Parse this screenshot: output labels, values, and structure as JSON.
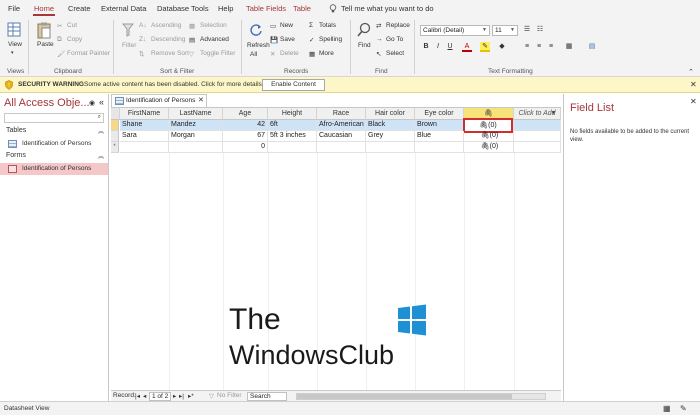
{
  "menu": {
    "tabs": [
      "File",
      "Home",
      "Create",
      "External Data",
      "Database Tools",
      "Help"
    ],
    "context_tabs": [
      "Table Fields",
      "Table"
    ],
    "tell_me": "Tell me what you want to do"
  },
  "ribbon": {
    "views": {
      "view": "View",
      "group": "Views"
    },
    "clipboard": {
      "paste": "Paste",
      "cut": "Cut",
      "copy": "Copy",
      "format_painter": "Format Painter",
      "group": "Clipboard"
    },
    "sort_filter": {
      "filter": "Filter",
      "ascending": "Ascending",
      "descending": "Descending",
      "remove_sort": "Remove Sort",
      "selection": "Selection",
      "advanced": "Advanced",
      "toggle_filter": "Toggle Filter",
      "group": "Sort & Filter"
    },
    "records": {
      "refresh": "Refresh",
      "refresh_all": "All",
      "new": "New",
      "save": "Save",
      "delete": "Delete",
      "totals": "Totals",
      "spelling": "Spelling",
      "more": "More",
      "group": "Records"
    },
    "find": {
      "find": "Find",
      "replace": "Replace",
      "goto": "Go To",
      "select": "Select",
      "group": "Find"
    },
    "text_formatting": {
      "font": "Calibri (Detail)",
      "size": "11",
      "bold": "B",
      "italic": "I",
      "underline": "U",
      "font_color": "A",
      "group": "Text Formatting"
    }
  },
  "security": {
    "label": "SECURITY WARNING",
    "message": "Some active content has been disabled. Click for more details.",
    "button": "Enable Content"
  },
  "nav": {
    "title": "All Access Obje...",
    "sections": [
      {
        "name": "Tables",
        "items": [
          "Identification of Persons"
        ]
      },
      {
        "name": "Forms",
        "items": [
          "Identification of Persons"
        ]
      }
    ]
  },
  "doc_tab": "Identification of Persons",
  "table": {
    "columns": [
      "FirstName",
      "LastName",
      "Age",
      "Height",
      "Race",
      "Hair color",
      "Eye color",
      "",
      "Click to Add"
    ],
    "rows": [
      [
        "Shane",
        "Mandez",
        "42",
        "6ft",
        "Afro-American",
        "Black",
        "Brown",
        "(0)"
      ],
      [
        "Sara",
        "Morgan",
        "67",
        "5ft 3 inches",
        "Caucasian",
        "Grey",
        "Blue",
        "(0)"
      ],
      [
        "",
        "",
        "0",
        "",
        "",
        "",
        "",
        "(0)"
      ]
    ],
    "new_marker": "*"
  },
  "record_nav": {
    "label": "Record:",
    "position": "1 of 2",
    "no_filter": "No Filter",
    "search": "Search"
  },
  "field_list": {
    "title": "Field List",
    "message": "No fields available to be added to the current view."
  },
  "status": {
    "text": "Datasheet View"
  },
  "watermark": {
    "line1": "The",
    "line2": "WindowsClub"
  },
  "colors": {
    "accent": "#a4373a",
    "warning_bg": "#fdf6c6",
    "selected_row": "#cfe3f6",
    "attachment_header": "#f7e37a"
  }
}
